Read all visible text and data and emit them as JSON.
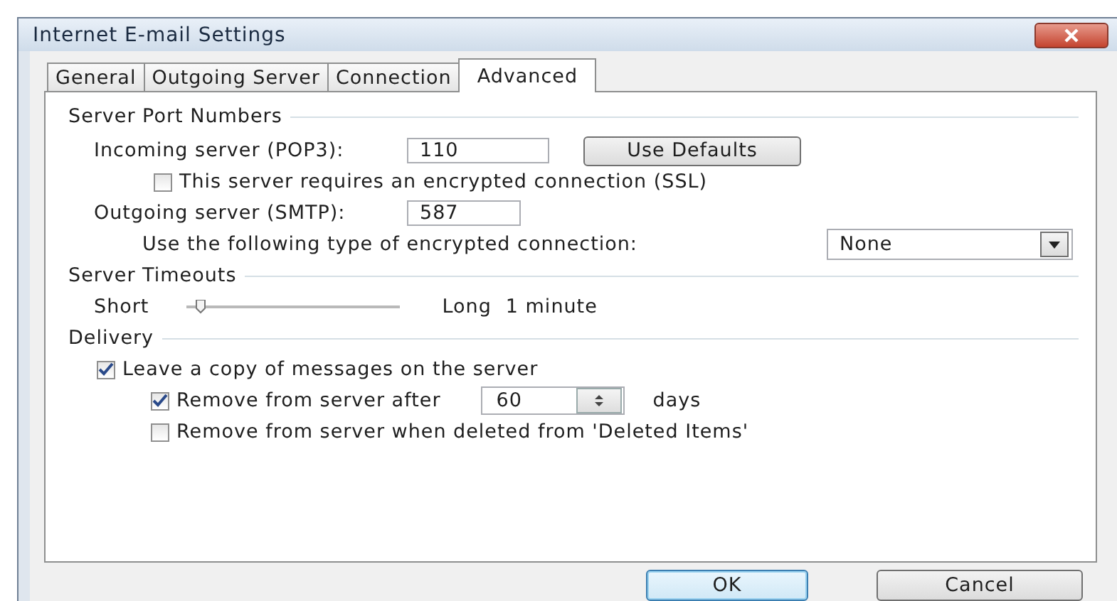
{
  "window": {
    "title": "Internet E-mail Settings"
  },
  "tabs": [
    {
      "label": "General",
      "selected": false
    },
    {
      "label": "Outgoing Server",
      "selected": false
    },
    {
      "label": "Connection",
      "selected": false
    },
    {
      "label": "Advanced",
      "selected": true
    }
  ],
  "server_port_numbers": {
    "title": "Server Port Numbers",
    "incoming_label": "Incoming server (POP3):",
    "incoming_value": "110",
    "use_defaults_button": "Use Defaults",
    "ssl": {
      "label": "This server requires an encrypted connection (SSL)",
      "checked": false
    },
    "outgoing_label": "Outgoing server (SMTP):",
    "outgoing_value": "587",
    "encryption_label": "Use the following type of encrypted connection:",
    "encryption_value": "None"
  },
  "server_timeouts": {
    "title": "Server Timeouts",
    "short_label": "Short",
    "long_label": "Long",
    "level": 0.04,
    "reading": "1 minute"
  },
  "delivery": {
    "title": "Delivery",
    "options": [
      {
        "kind": "checkbox",
        "label": "Leave a copy of messages on the server",
        "checked": true,
        "children": [
          {
            "kind": "spinner",
            "label": "Remove from server after",
            "checked": true,
            "value": "60",
            "unit": "days"
          },
          {
            "kind": "checkbox",
            "label": "Remove from server when deleted from 'Deleted Items'",
            "checked": false
          }
        ]
      }
    ]
  },
  "buttons": [
    {
      "label": "OK",
      "default": true
    },
    {
      "label": "Cancel",
      "default": false
    }
  ]
}
